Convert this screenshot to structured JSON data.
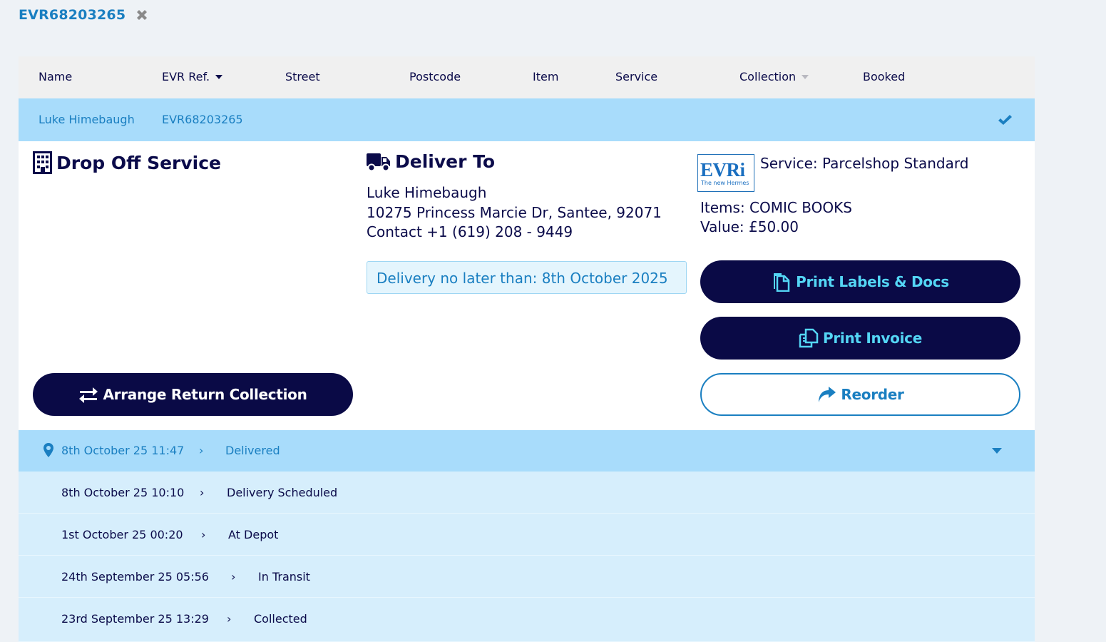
{
  "tab": {
    "title": "EVR68203265",
    "close_icon": "close-icon"
  },
  "table": {
    "headers": [
      {
        "label": "Name",
        "sort": ""
      },
      {
        "label": "EVR Ref.",
        "sort": "desc"
      },
      {
        "label": "Street",
        "sort": ""
      },
      {
        "label": "Postcode",
        "sort": ""
      },
      {
        "label": "Item",
        "sort": ""
      },
      {
        "label": "Service",
        "sort": ""
      },
      {
        "label": "Collection",
        "sort": "inactive"
      },
      {
        "label": "Booked",
        "sort": ""
      }
    ],
    "selected_row": {
      "name": "Luke Himebaugh",
      "ref": "EVR68203265",
      "status_icon": "check-icon"
    }
  },
  "drop_off": {
    "title": "Drop Off Service",
    "icon": "building-icon"
  },
  "deliver_to": {
    "title": "Deliver To",
    "icon": "truck-icon",
    "name": "Luke Himebaugh",
    "address": "10275 Princess Marcie Dr, Santee, 92071",
    "contact": "Contact +1 (619) 208 - 9449",
    "deadline": "Delivery no later than: 8th October 2025"
  },
  "service": {
    "logo_text": "EVRi",
    "logo_subtext": "The new Hermes",
    "service_label": "Service: Parcelshop Standard",
    "items": "Items: COMIC BOOKS",
    "value": "Value: £50.00"
  },
  "actions": {
    "arrange_return": "Arrange Return Collection",
    "print_labels": "Print Labels & Docs",
    "print_invoice": "Print Invoice",
    "reorder": "Reorder"
  },
  "tracking": {
    "latest": {
      "date": "8th October 25 11:47",
      "sep": "›",
      "status": "Delivered"
    },
    "history": [
      {
        "date": "8th October 25 10:10",
        "sep": "›",
        "status": "Delivery Scheduled"
      },
      {
        "date": "1st October 25 00:20",
        "sep": "›",
        "status": "At Depot"
      },
      {
        "date": "24th September 25 05:56",
        "sep": "›",
        "status": "In Transit"
      },
      {
        "date": "23rd September 25 13:29",
        "sep": "›",
        "status": "Collected"
      }
    ]
  },
  "colors": {
    "navy": "#0a0a46",
    "accent_blue": "#1a7fc1",
    "highlight_row": "#a8dcfb",
    "history_row": "#d6eefc",
    "cyan_label": "#54d6f5"
  }
}
